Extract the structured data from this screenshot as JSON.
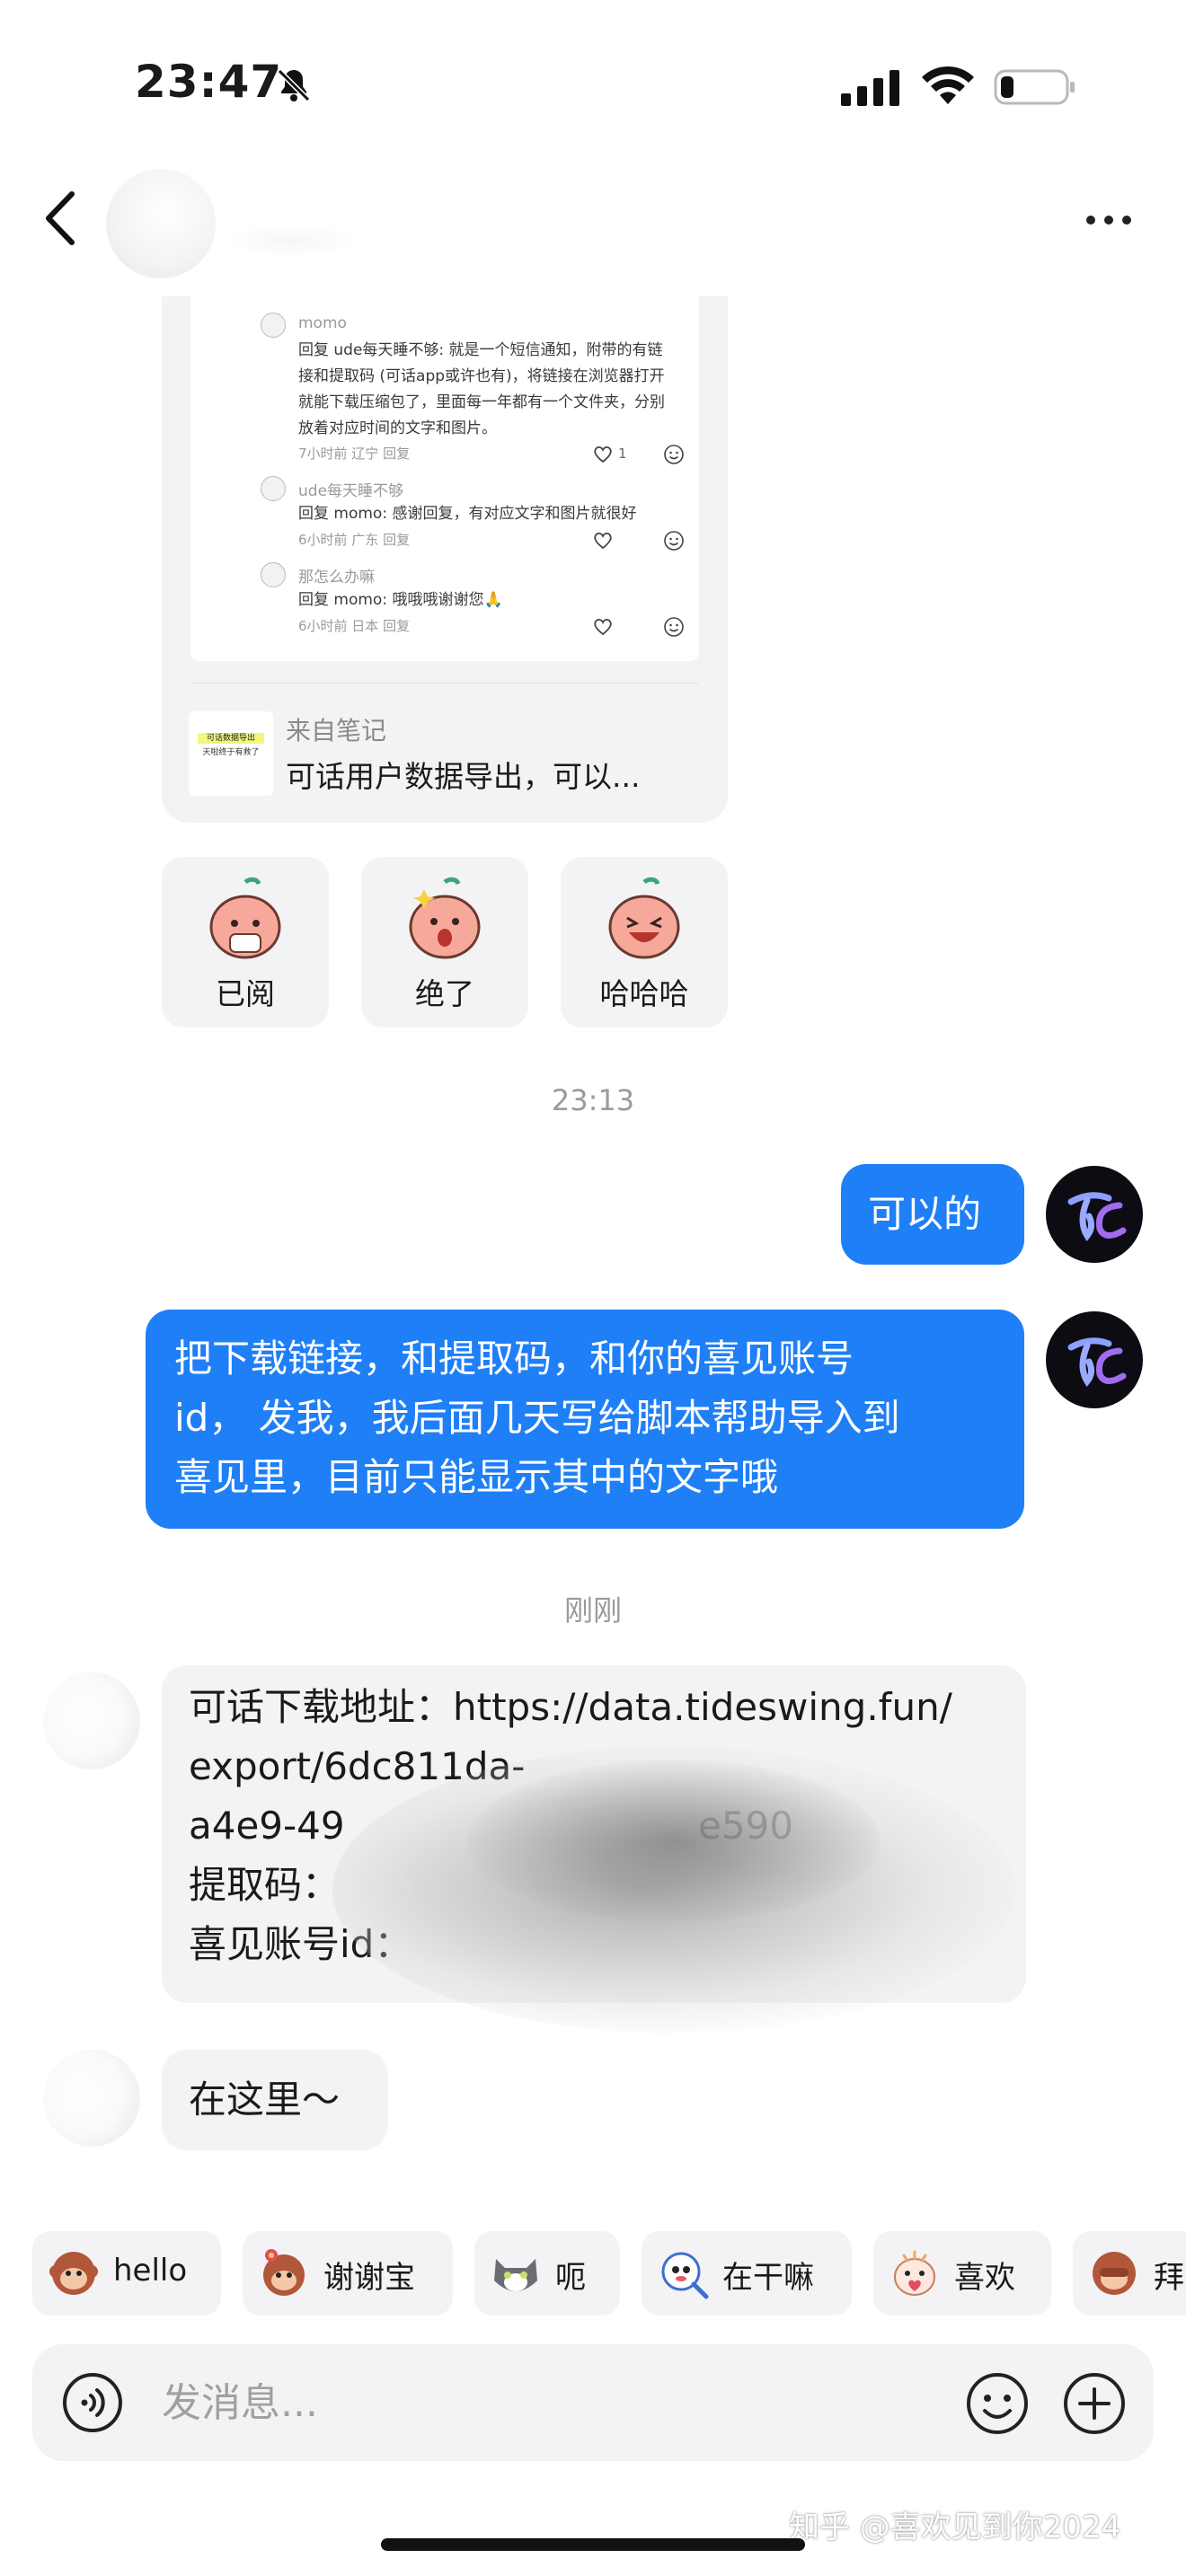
{
  "status_bar": {
    "time": "23:47"
  },
  "note_card": {
    "comments": [
      {
        "name": "momo",
        "text": "回复 ude每天睡不够: 就是一个短信通知，附带的有链接和提取码 (可话app或许也有)，将链接在浏览器打开就能下载压缩包了，里面每一年都有一个文件夹，分别放着对应时间的文字和图片。",
        "meta": "7小时前 辽宁 回复",
        "likes": "1"
      },
      {
        "name": "ude每天睡不够",
        "text": "回复 momo: 感谢回复，有对应文字和图片就很好",
        "meta": "6小时前 广东 回复"
      },
      {
        "name": "那怎么办嘛",
        "text": "回复 momo: 哦哦哦谢谢您🙏",
        "meta": "6小时前 日本 回复"
      }
    ],
    "thumb_line1": "可话数据导出",
    "thumb_line2": "天啦终于有救了",
    "from_label": "来自笔记",
    "title": "可话用户数据导出，可以..."
  },
  "sticker_replies": [
    {
      "label": "已阅"
    },
    {
      "label": "绝了"
    },
    {
      "label": "哈哈哈"
    }
  ],
  "timestamps": {
    "first": "23:13",
    "second": "刚刚"
  },
  "messages": {
    "out_1": "可以的",
    "out_2_line1": "把下载链接，和提取码，和你的喜见账号",
    "out_2_line2": "id， 发我，我后面几天写给脚本帮助导入到",
    "out_2_line3": "喜见里，目前只能显示其中的文字哦",
    "in_1_line1": "可话下载地址：https://data.tideswing.fun/",
    "in_1_line2": "export/6dc811da-",
    "in_1_line3": "a4e9-49",
    "in_1_line3_tail": "e590",
    "in_1_line4": "提取码：",
    "in_1_line5": "喜见账号id：",
    "in_2": "在这里～"
  },
  "quick_chips": [
    {
      "label": "hello",
      "icon": "monkey-icon"
    },
    {
      "label": "谢谢宝",
      "icon": "monkey-flower-icon"
    },
    {
      "label": "呃",
      "icon": "cat-icon"
    },
    {
      "label": "在干嘛",
      "icon": "magnifier-icon"
    },
    {
      "label": "喜欢",
      "icon": "heart-hands-icon"
    },
    {
      "label": "拜",
      "icon": "monkey-bye-icon"
    }
  ],
  "input": {
    "placeholder": "发消息..."
  },
  "watermark": "知乎 @喜欢见到你2024",
  "colors": {
    "accent": "#1e7ff7",
    "bubble_gray": "#f3f3f5",
    "timestamp": "#9a9a9a"
  }
}
